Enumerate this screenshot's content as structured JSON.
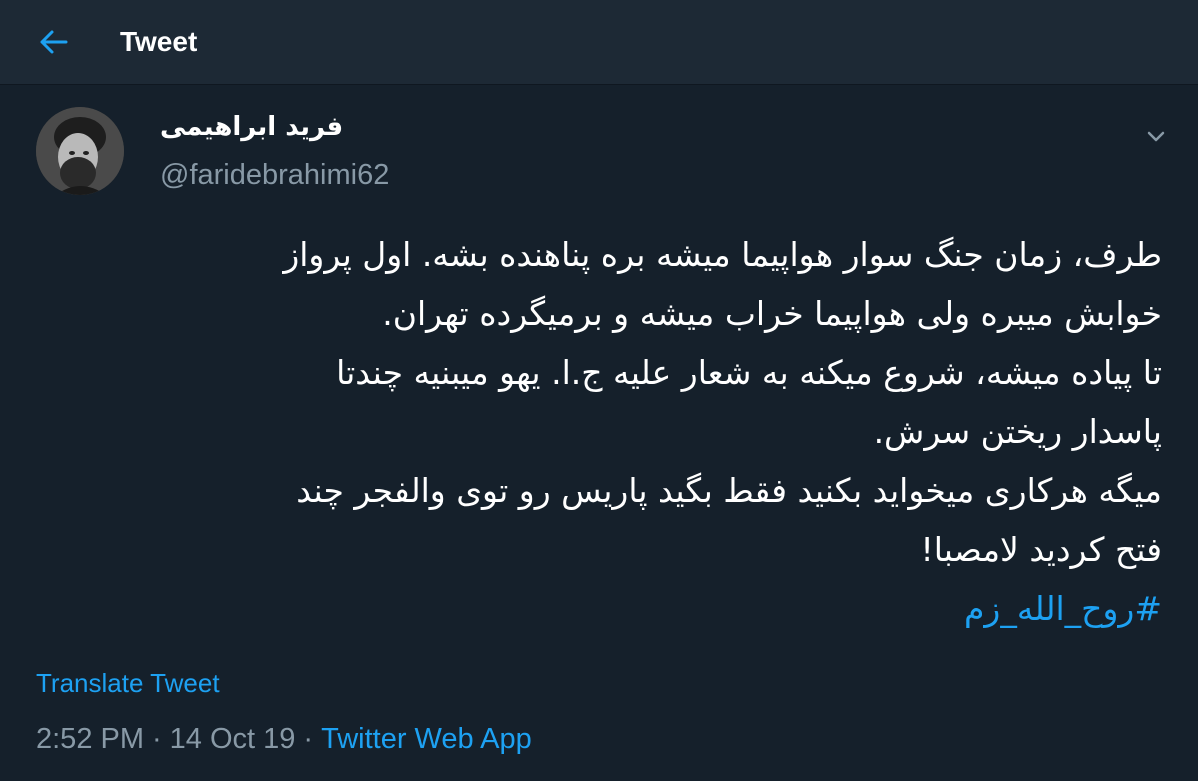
{
  "header": {
    "title": "Tweet",
    "back_icon": "arrow-left-icon"
  },
  "colors": {
    "background": "#15202b",
    "header_background": "#1d2935",
    "accent": "#1da1f2",
    "secondary_text": "#8899a6",
    "primary_text": "#ffffff"
  },
  "tweet": {
    "author": {
      "display_name": "فرید ابراهیمی",
      "handle": "@faridebrahimi62"
    },
    "caret_icon": "chevron-down-icon",
    "lines": [
      "طرف، زمان جنگ سوار هواپیما میشه بره پناهنده بشه. اول پرواز",
      "خوابش میبره ولی هواپیما خراب میشه و برمیگرده تهران.",
      "تا پیاده میشه، شروع میکنه به شعار علیه ج.ا. یهو میبنیه چندتا",
      "پاسدار ریختن سرش.",
      "میگه هرکاری میخواید بکنید فقط بگید پاریس رو توی والفجر چند",
      "فتح کردید لامصبا!"
    ],
    "hashtag": "#روح_الله_زم",
    "translate_label": "Translate Tweet",
    "time": "2:52 PM",
    "date": "14 Oct 19",
    "separator": "·",
    "source": "Twitter Web App"
  }
}
